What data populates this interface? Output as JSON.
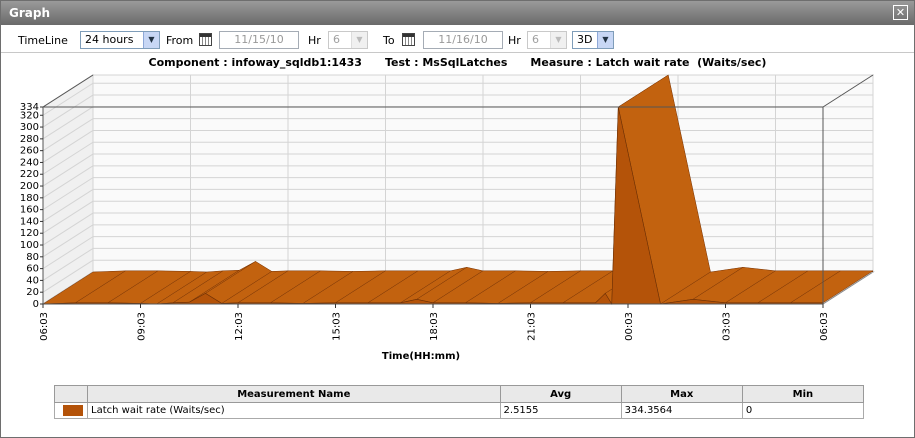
{
  "window": {
    "title": "Graph"
  },
  "toolbar": {
    "timeline_label": "TimeLine",
    "timeline_value": "24 hours",
    "from_label": "From",
    "from_date": "11/15/10",
    "hr1_label": "Hr",
    "hr1_value": "6",
    "to_label": "To",
    "to_date": "11/16/10",
    "hr2_label": "Hr",
    "hr2_value": "6",
    "view_value": "3D"
  },
  "chart_heading": {
    "component": "Component : infoway_sqldb1:1433",
    "test": "Test : MsSqlLatches",
    "measure": "Measure : Latch wait rate  (Waits/sec)"
  },
  "chart_data": {
    "type": "area",
    "xlabel": "Time(HH:mm)",
    "ylabel": "",
    "ylim": [
      0,
      334
    ],
    "y_ticks": [
      0,
      20,
      40,
      60,
      80,
      100,
      120,
      140,
      160,
      180,
      200,
      220,
      240,
      260,
      280,
      300,
      320,
      334
    ],
    "x_ticks": [
      "06:03",
      "09:03",
      "12:03",
      "15:03",
      "18:03",
      "21:03",
      "00:03",
      "03:03",
      "06:03"
    ],
    "x_hours": [
      0,
      3,
      6,
      9,
      12,
      15,
      18,
      21,
      24
    ],
    "series": [
      {
        "name": "Latch wait rate (Waits/sec)",
        "color": "#b45309",
        "x": [
          0,
          1,
          2,
          3,
          3.5,
          4,
          4.5,
          5,
          5.5,
          6,
          7,
          8,
          9,
          10,
          11,
          11.5,
          12,
          13,
          14,
          15,
          16,
          17,
          17.3,
          17.5,
          17.7,
          19,
          20,
          21,
          22,
          23,
          24
        ],
        "y": [
          0,
          2,
          2,
          1,
          0,
          2,
          3,
          18,
          1,
          2,
          2,
          1,
          2,
          2,
          2,
          8,
          2,
          2,
          1,
          2,
          2,
          2,
          18,
          0,
          334,
          0,
          8,
          2,
          2,
          2,
          2
        ]
      }
    ]
  },
  "table": {
    "headers": [
      "",
      "Measurement Name",
      "Avg",
      "Max",
      "Min"
    ],
    "rows": [
      {
        "name": "Latch wait rate (Waits/sec)",
        "avg": "2.5155",
        "max": "334.3564",
        "min": "0"
      }
    ]
  },
  "colors": {
    "accent": "#b45309",
    "titlebar": "#7a7a7a"
  }
}
